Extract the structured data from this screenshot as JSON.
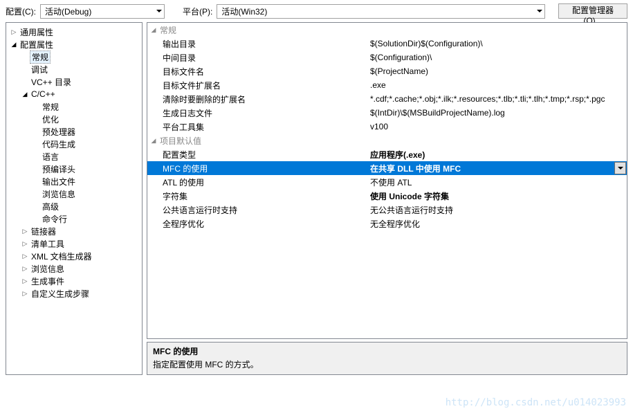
{
  "toolbar": {
    "config_label": "配置(C):",
    "config_value": "活动(Debug)",
    "platform_label": "平台(P):",
    "platform_value": "活动(Win32)",
    "manager_btn": "配置管理器(O)..."
  },
  "tree": [
    {
      "label": "通用属性",
      "exp": "closed",
      "depth": 0
    },
    {
      "label": "配置属性",
      "exp": "open",
      "depth": 0
    },
    {
      "label": "常规",
      "exp": "none",
      "depth": 1,
      "sel": true
    },
    {
      "label": "调试",
      "exp": "none",
      "depth": 1
    },
    {
      "label": "VC++ 目录",
      "exp": "none",
      "depth": 1
    },
    {
      "label": "C/C++",
      "exp": "open",
      "depth": 1
    },
    {
      "label": "常规",
      "exp": "none",
      "depth": 2
    },
    {
      "label": "优化",
      "exp": "none",
      "depth": 2
    },
    {
      "label": "预处理器",
      "exp": "none",
      "depth": 2
    },
    {
      "label": "代码生成",
      "exp": "none",
      "depth": 2
    },
    {
      "label": "语言",
      "exp": "none",
      "depth": 2
    },
    {
      "label": "预编译头",
      "exp": "none",
      "depth": 2
    },
    {
      "label": "输出文件",
      "exp": "none",
      "depth": 2
    },
    {
      "label": "浏览信息",
      "exp": "none",
      "depth": 2
    },
    {
      "label": "高级",
      "exp": "none",
      "depth": 2
    },
    {
      "label": "命令行",
      "exp": "none",
      "depth": 2
    },
    {
      "label": "链接器",
      "exp": "closed",
      "depth": 1
    },
    {
      "label": "清单工具",
      "exp": "closed",
      "depth": 1
    },
    {
      "label": "XML 文档生成器",
      "exp": "closed",
      "depth": 1
    },
    {
      "label": "浏览信息",
      "exp": "closed",
      "depth": 1
    },
    {
      "label": "生成事件",
      "exp": "closed",
      "depth": 1
    },
    {
      "label": "自定义生成步骤",
      "exp": "closed",
      "depth": 1
    }
  ],
  "groups": [
    {
      "title": "常规",
      "props": [
        {
          "name": "输出目录",
          "value": "$(SolutionDir)$(Configuration)\\"
        },
        {
          "name": "中间目录",
          "value": "$(Configuration)\\"
        },
        {
          "name": "目标文件名",
          "value": "$(ProjectName)"
        },
        {
          "name": "目标文件扩展名",
          "value": ".exe"
        },
        {
          "name": "清除时要删除的扩展名",
          "value": "*.cdf;*.cache;*.obj;*.ilk;*.resources;*.tlb;*.tli;*.tlh;*.tmp;*.rsp;*.pgc"
        },
        {
          "name": "生成日志文件",
          "value": "$(IntDir)\\$(MSBuildProjectName).log"
        },
        {
          "name": "平台工具集",
          "value": "v100"
        }
      ]
    },
    {
      "title": "项目默认值",
      "props": [
        {
          "name": "配置类型",
          "value": "应用程序(.exe)",
          "bold": true
        },
        {
          "name": "MFC 的使用",
          "value": "在共享 DLL 中使用 MFC",
          "bold": true,
          "selected": true
        },
        {
          "name": "ATL 的使用",
          "value": "不使用 ATL"
        },
        {
          "name": "字符集",
          "value": "使用 Unicode 字符集",
          "bold": true
        },
        {
          "name": "公共语言运行时支持",
          "value": "无公共语言运行时支持"
        },
        {
          "name": "全程序优化",
          "value": "无全程序优化"
        }
      ]
    }
  ],
  "desc": {
    "title": "MFC 的使用",
    "body": "指定配置使用 MFC 的方式。"
  },
  "watermark": "http://blog.csdn.net/u014023993"
}
